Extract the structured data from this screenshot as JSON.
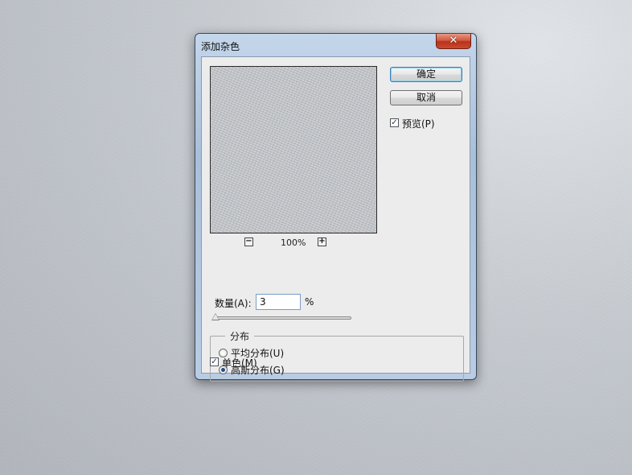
{
  "dialog": {
    "title": "添加杂色",
    "close_glyph": "✕"
  },
  "preview": {
    "zoom_out": "−",
    "zoom_level": "100%",
    "zoom_in": "+"
  },
  "buttons": {
    "ok": "确定",
    "cancel": "取消"
  },
  "preview_checkbox": {
    "label": "预览(P)",
    "checked": true
  },
  "amount": {
    "label": "数量(A):",
    "value": "3",
    "unit": "%"
  },
  "distribution": {
    "group_label": "分布",
    "options": [
      {
        "label": "平均分布(U)",
        "selected": false
      },
      {
        "label": "高斯分布(G)",
        "selected": true
      }
    ]
  },
  "monochromatic": {
    "label": "单色(M)",
    "checked": true
  },
  "check_glyph": "✓",
  "colors": {
    "title_bar": "#b8cde4",
    "close_button": "#c94b2f",
    "default_button_border": "#3c7fb1"
  }
}
